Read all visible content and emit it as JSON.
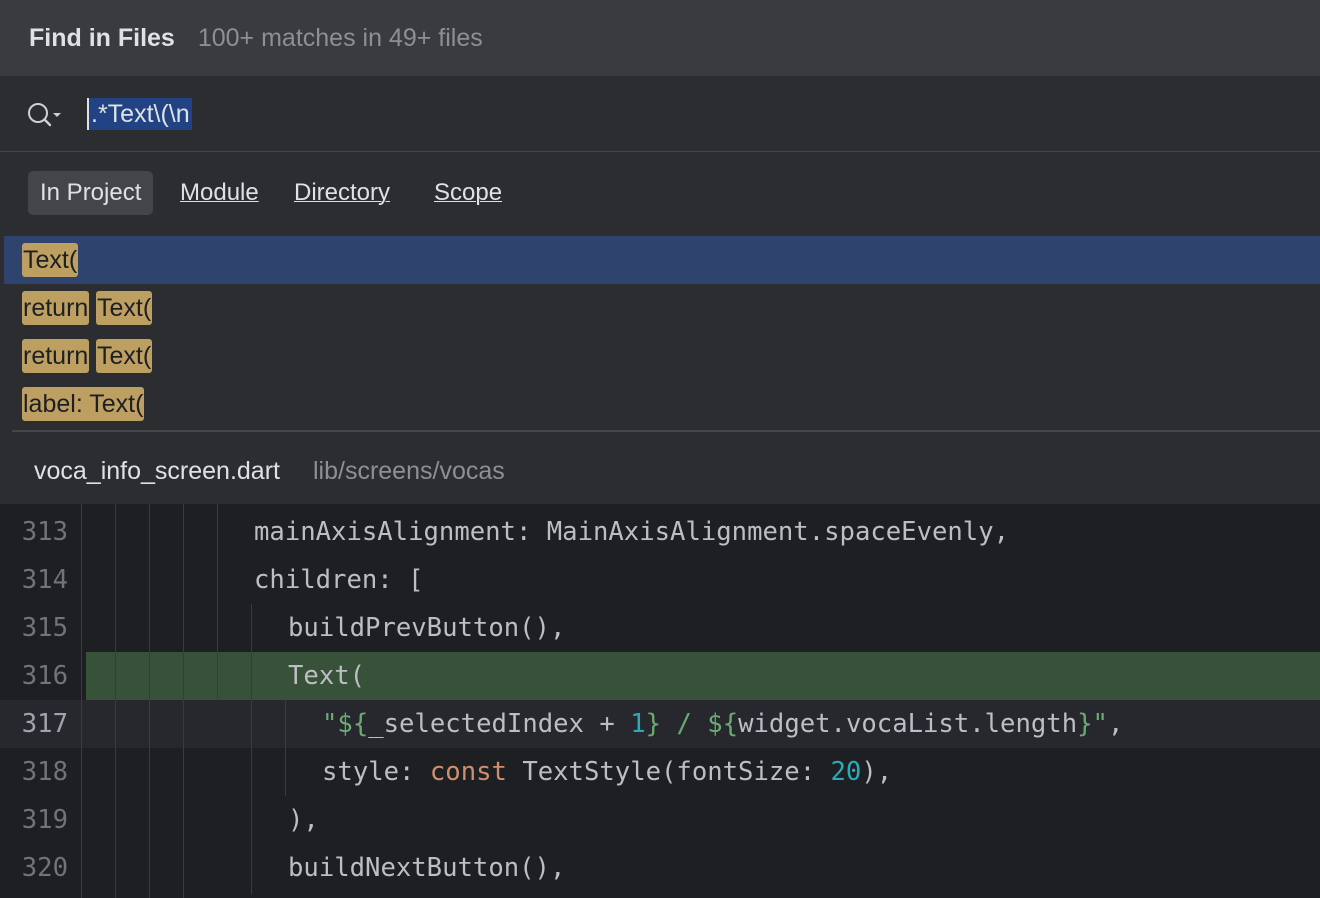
{
  "header": {
    "title": "Find in Files",
    "summary": "100+ matches in 49+ files"
  },
  "search": {
    "query": ".*Text\\(\\n"
  },
  "scopes": [
    {
      "label": "In Project",
      "active": true
    },
    {
      "label": "Module",
      "active": false
    },
    {
      "label": "Directory",
      "active": false
    },
    {
      "label": "Scope",
      "active": false
    }
  ],
  "results": [
    {
      "segments": [
        "Text("
      ],
      "selected": true
    },
    {
      "segments": [
        "return",
        "Text("
      ],
      "selected": false
    },
    {
      "segments": [
        "return",
        "Text("
      ],
      "selected": false
    },
    {
      "segments": [
        "label: Text("
      ],
      "selected": false
    }
  ],
  "preview": {
    "filename": "voca_info_screen.dart",
    "path": "lib/screens/vocas",
    "lines": [
      {
        "num": "313",
        "text": "mainAxisAlignment: MainAxisAlignment.spaceEvenly,"
      },
      {
        "num": "314",
        "text": "children: ["
      },
      {
        "num": "315",
        "text": "buildPrevButton(),"
      },
      {
        "num": "316",
        "text": "Text("
      },
      {
        "num": "317",
        "text": "\"${_selectedIndex + 1} / ${widget.vocaList.length}\","
      },
      {
        "num": "318",
        "text": "style: const TextStyle(fontSize: 20),"
      },
      {
        "num": "319",
        "text": "),"
      },
      {
        "num": "320",
        "text": "buildNextButton(),"
      }
    ]
  },
  "colors": {
    "accent_selection": "#2e436e",
    "match_highlight": "#bd9f62",
    "match_line": "#375239"
  }
}
